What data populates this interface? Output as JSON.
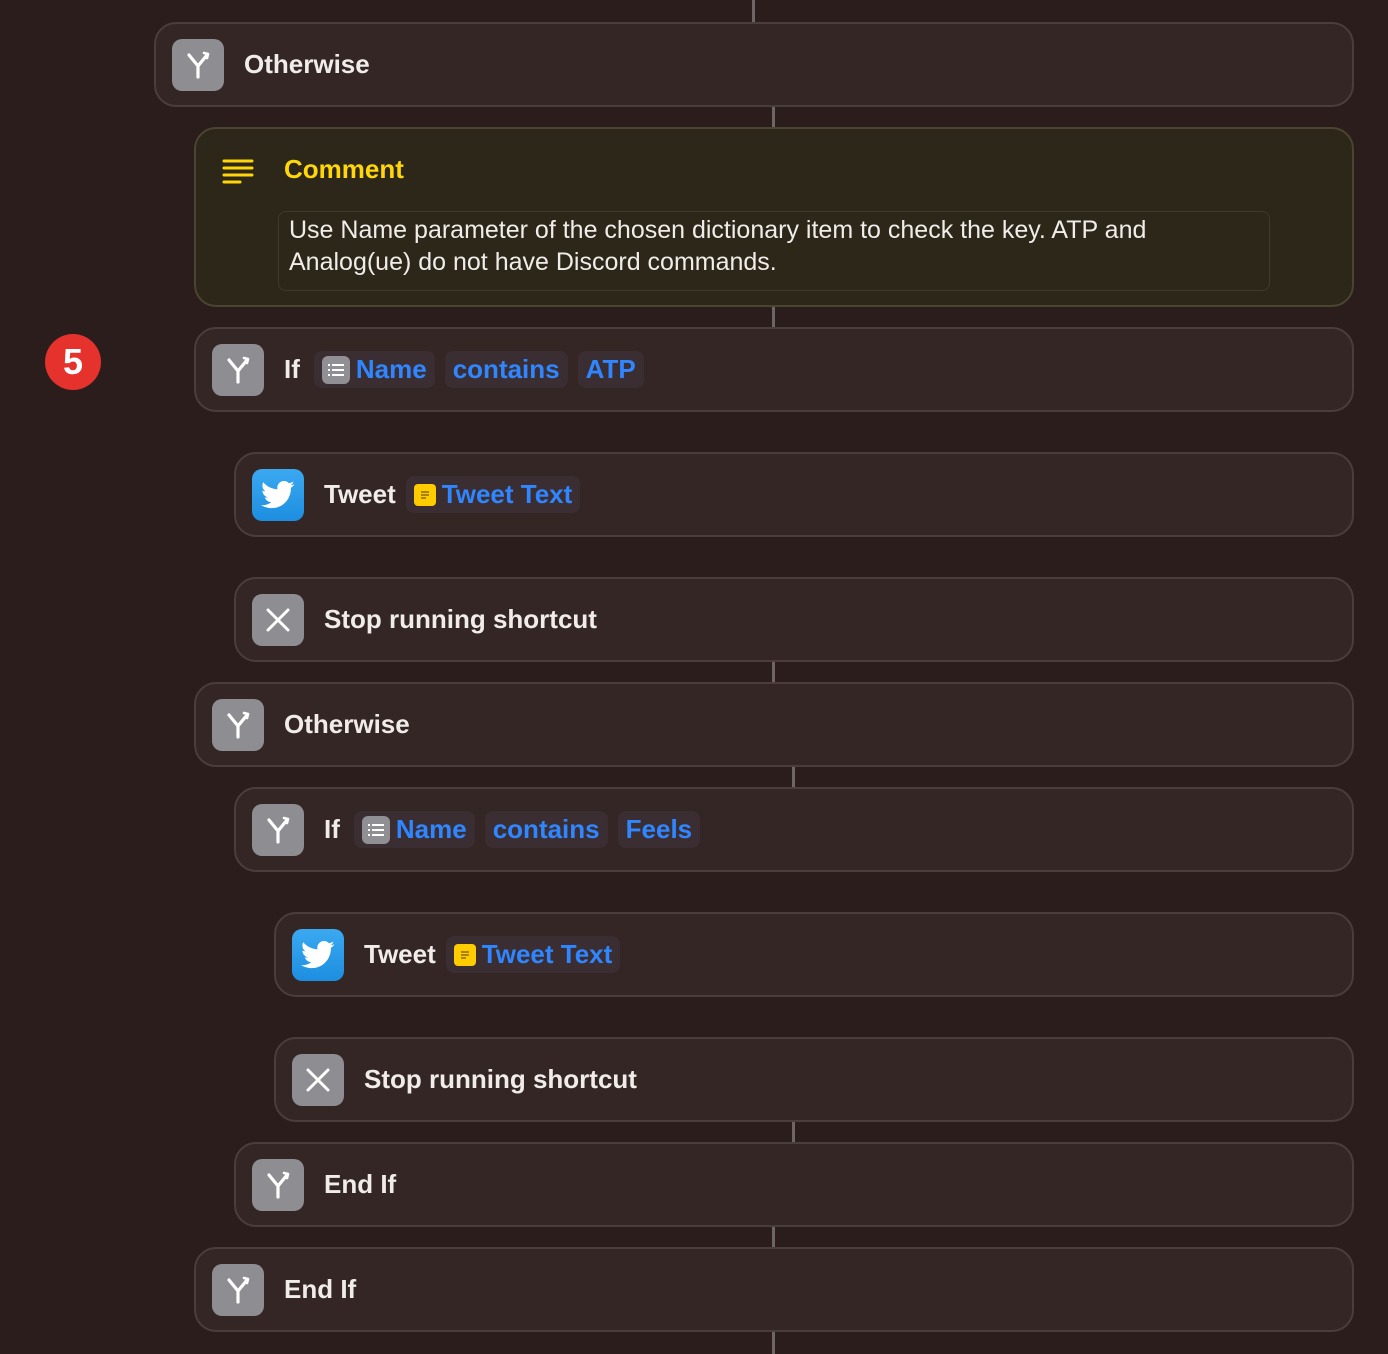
{
  "step_badge": "5",
  "blocks": {
    "otherwise_1": {
      "label": "Otherwise"
    },
    "comment": {
      "title": "Comment",
      "text": "Use Name parameter of the chosen dictionary item to check the key. ATP and Analog(ue) do not have Discord commands."
    },
    "if_1": {
      "keyword": "If",
      "variable": "Name",
      "operator": "contains",
      "value": "ATP"
    },
    "tweet_1": {
      "action": "Tweet",
      "variable": "Tweet Text"
    },
    "stop_1": {
      "label": "Stop running shortcut"
    },
    "otherwise_2": {
      "label": "Otherwise"
    },
    "if_2": {
      "keyword": "If",
      "variable": "Name",
      "operator": "contains",
      "value": "Feels"
    },
    "tweet_2": {
      "action": "Tweet",
      "variable": "Tweet Text"
    },
    "stop_2": {
      "label": "Stop running shortcut"
    },
    "end_if_1": {
      "label": "End If"
    },
    "end_if_2": {
      "label": "End If"
    }
  },
  "icons": {
    "branch": "branch-icon",
    "comment": "comment-lines-icon",
    "twitter": "twitter-icon",
    "stop": "close-icon",
    "variable_list": "list-icon",
    "variable_note": "note-icon"
  },
  "colors": {
    "background": "#2a1d1b",
    "card": "#332624",
    "comment_card": "#2c2719",
    "token_text": "#2f86ff",
    "comment_accent": "#ffd60a",
    "badge": "#e5322d",
    "twitter": "#1d9bf0"
  }
}
